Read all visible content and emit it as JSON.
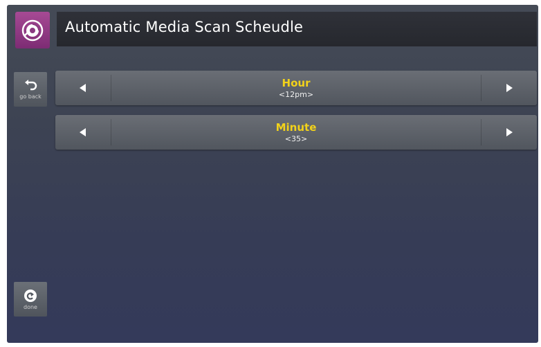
{
  "header": {
    "title": "Automatic Media Scan Scheudle",
    "app_icon": "media-scan-icon"
  },
  "sidebar": {
    "back": {
      "label": "go back",
      "icon": "undo-arrow-icon"
    },
    "done": {
      "label": "done",
      "icon": "redo-circle-icon"
    }
  },
  "pickers": [
    {
      "label": "Hour",
      "value": "<12pm>"
    },
    {
      "label": "Minute",
      "value": "<35>"
    }
  ],
  "colors": {
    "label_accent": "#f2d21a",
    "app_tile": "#96408a"
  }
}
